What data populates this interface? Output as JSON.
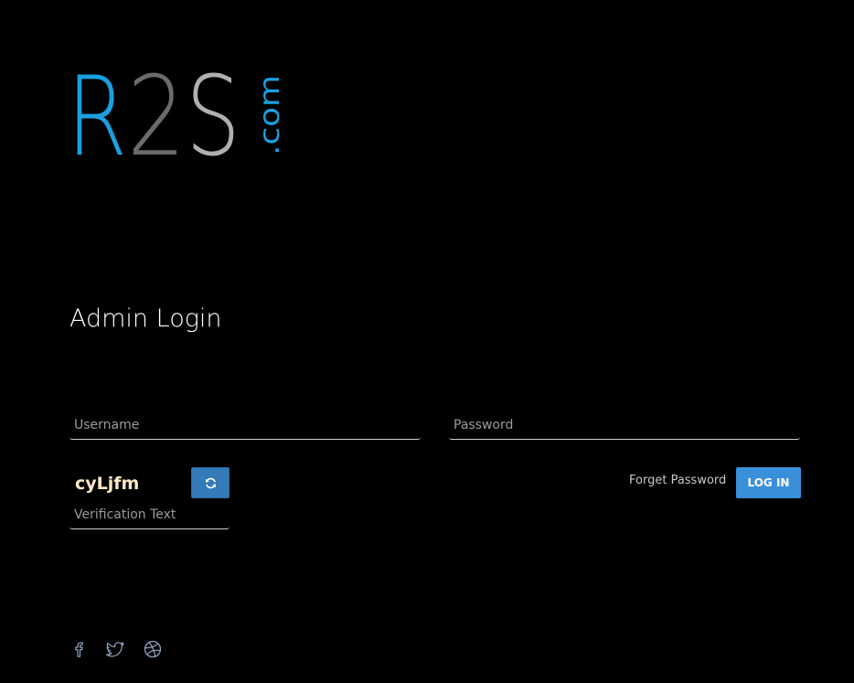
{
  "logo": {
    "r_letter": "R",
    "two_letter": "2",
    "s_letter": "S",
    "dotcom": ".com",
    "colors": {
      "blue": "#1aa0e0",
      "gray_dark": "#6b6b6b",
      "gray_light": "#b0b0b0"
    }
  },
  "title": "Admin Login",
  "form": {
    "username_placeholder": "Username",
    "username_value": "",
    "password_placeholder": "Password",
    "password_value": "",
    "captcha_text": "cyLjfm",
    "refresh_icon": "refresh-icon",
    "verification_placeholder": "Verification Text",
    "verification_value": "",
    "forgot_label": "Forget Password",
    "login_label": "LOG IN"
  },
  "social": [
    {
      "name": "facebook-icon"
    },
    {
      "name": "twitter-icon"
    },
    {
      "name": "dribbble-icon"
    }
  ],
  "colors": {
    "background": "#000000",
    "accent": "#3a8fd9",
    "captcha": "#ffe9c6"
  }
}
